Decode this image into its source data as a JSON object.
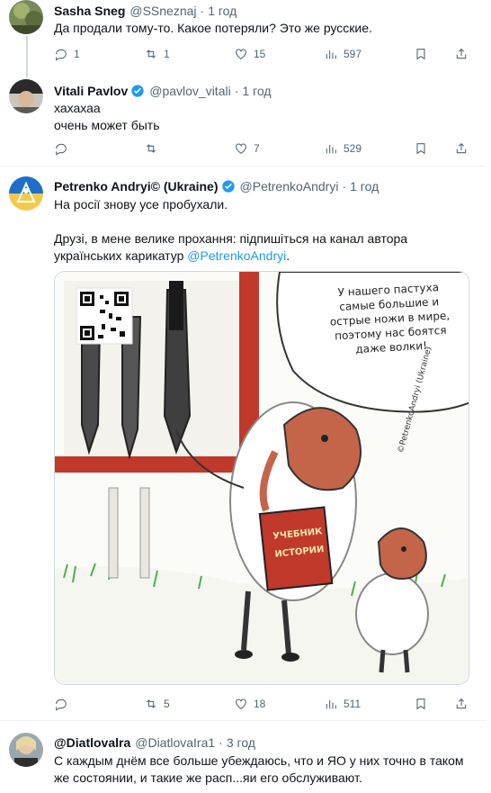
{
  "tweets": [
    {
      "name": "Sasha Sneg",
      "handle": "@SSneznaj",
      "time": "1 год",
      "text": "Да продали тому-то. Какое потеряли? Это же русские.",
      "replies": "1",
      "reposts": "1",
      "likes": "15",
      "views": "597"
    },
    {
      "name": "Vitali Pavlov",
      "handle": "@pavlov_vitali",
      "time": "1 год",
      "text1": "хахахаа",
      "text2": "очень может быть",
      "likes": "7",
      "views": "529"
    },
    {
      "name": "Petrenko Andryi© (Ukraine)",
      "handle": "@PetrenkoAndryi",
      "time": "1 год",
      "text1": "На росії знову усе пробухали.",
      "text2": "Друзі, в мене велике прохання: підпишіться на канал автора українських карикатур",
      "mention": "@PetrenkoAndryi",
      "period": ".",
      "reposts": "5",
      "likes": "18",
      "views": "511",
      "cartoon": {
        "speech": [
          "У нашего пастуха",
          "самые большие и",
          "острые ножи в мире,",
          "поэтому нас боятся",
          "даже волки!"
        ],
        "book": [
          "УЧЕБНИК",
          "ИСТОРИИ"
        ],
        "signature": "©PetrenkoAndryi (Ukraine)"
      }
    },
    {
      "name": "@Diatlovalra",
      "handle": "@DiatlovaIra1",
      "time": "3 год",
      "text1": "С каждым днём все больше убеждаюсь, что и ЯО у них точно в таком",
      "text2": "же состоянии, и такие же расп...яи его обслуживают."
    }
  ],
  "colors": {
    "accent": "#1d9bf0",
    "muted": "#536471",
    "divider": "#eff3f4"
  },
  "icons": [
    "reply-icon",
    "repost-icon",
    "like-icon",
    "views-icon",
    "bookmark-icon",
    "share-icon",
    "verified-icon"
  ]
}
